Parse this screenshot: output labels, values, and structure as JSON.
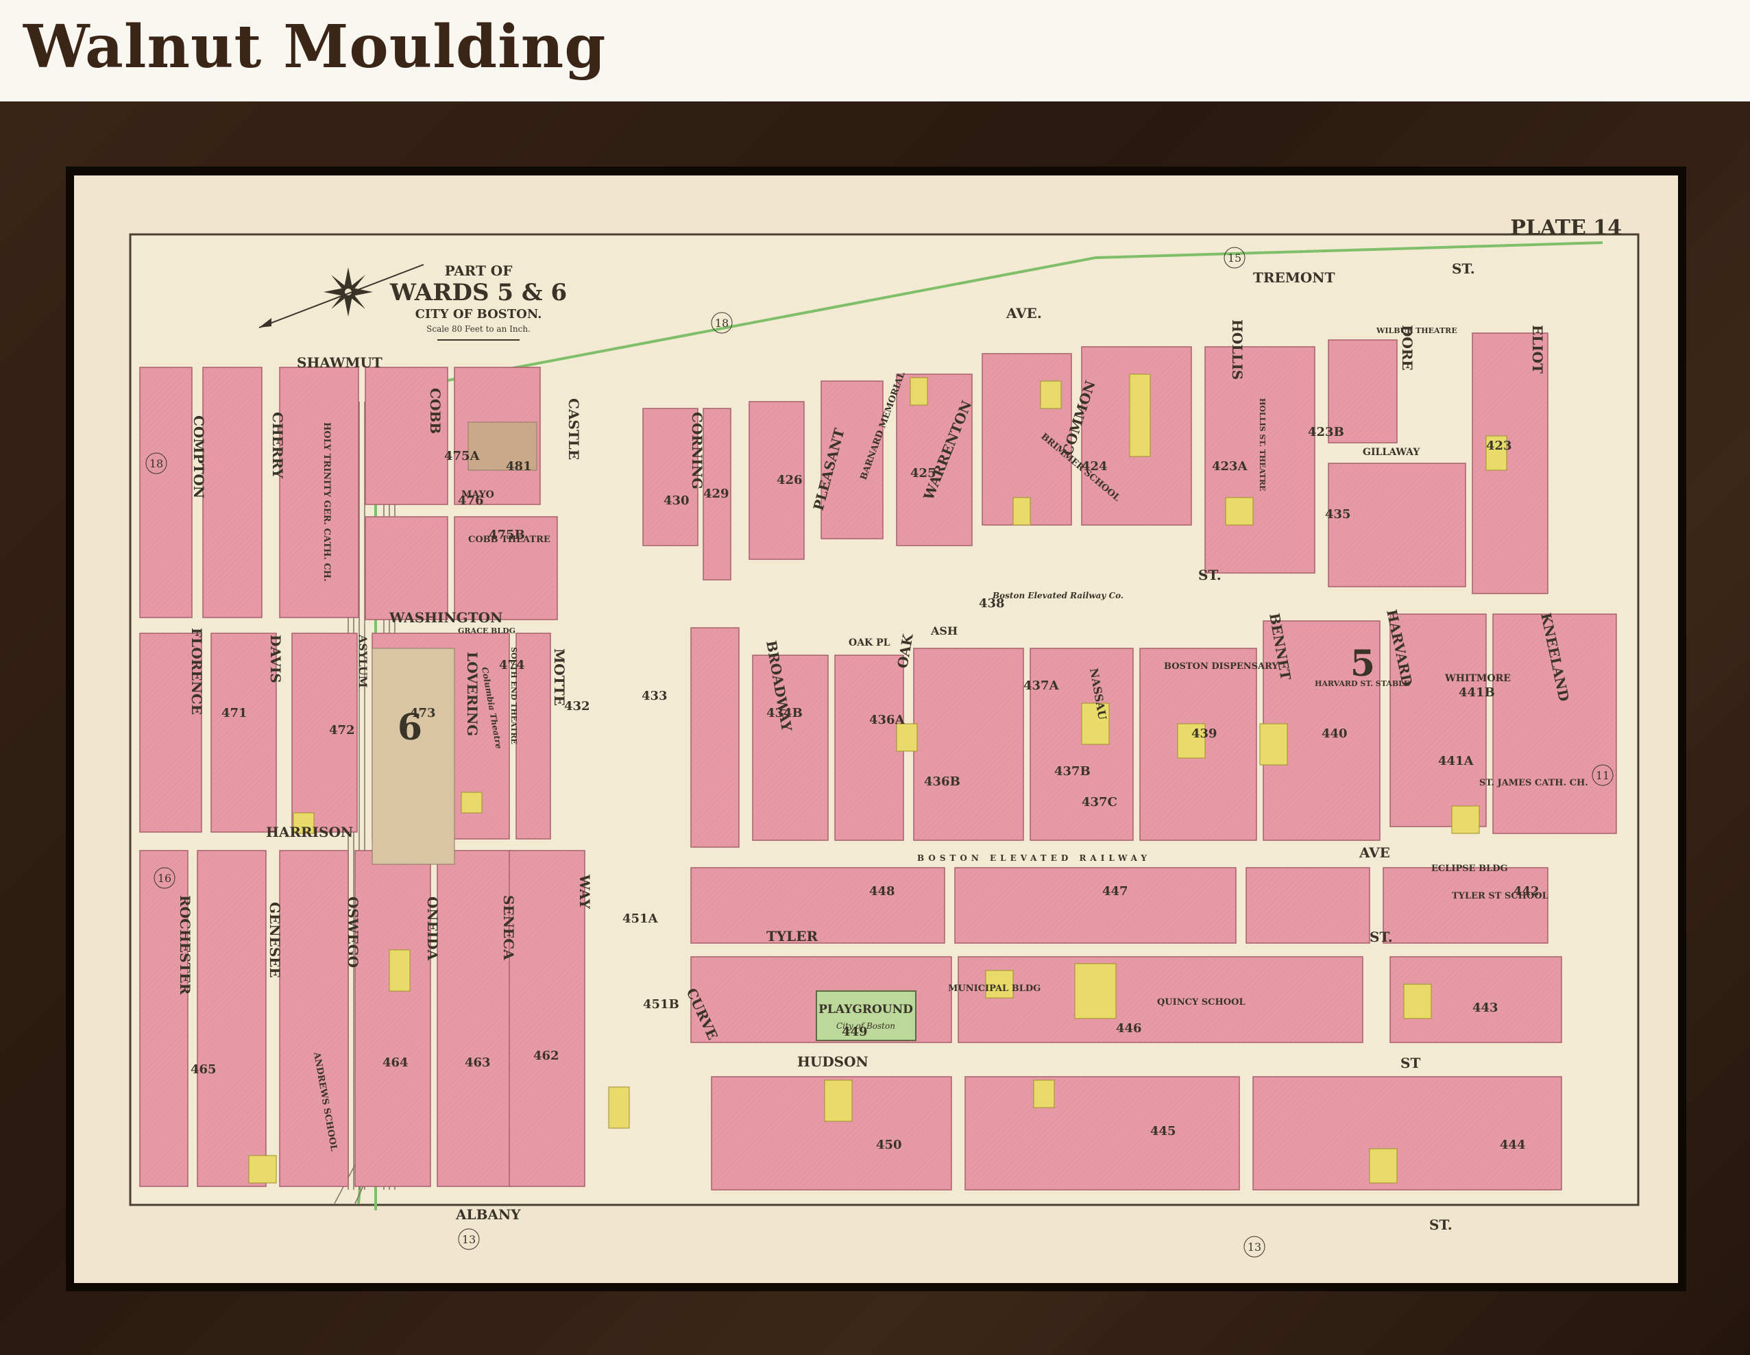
{
  "header": {
    "title": "Walnut Moulding"
  },
  "map": {
    "plate": "PLATE 14",
    "title": {
      "line1": "PART OF",
      "line2": "WARDS 5 & 6",
      "line3": "CITY OF BOSTON.",
      "scale": "Scale 80 Feet to an Inch."
    },
    "adjacent_plates": {
      "top": "15",
      "top_left": "18",
      "left_upper": "18",
      "left_lower": "16",
      "right": "11",
      "bottom_left": "13",
      "bottom_mid": "13"
    },
    "ward_numbers": {
      "ward6": "6",
      "ward5": "5"
    },
    "streets": {
      "tremont": "TREMONT",
      "ave_top": "AVE.",
      "st_top": "ST.",
      "shawmut": "SHAWMUT",
      "compton": "COMPTON",
      "cherry": "CHERRY",
      "cobb": "COBB",
      "castle": "CASTLE",
      "corning": "CORNING",
      "pleasant": "PLEASANT",
      "warrenton": "WARRENTON",
      "common": "COMMON",
      "hollis": "HOLLIS",
      "dore": "DORE",
      "eliot": "ELIOT",
      "mayo": "MAYO",
      "gillaway": "GILLAWAY",
      "washington": "WASHINGTON",
      "washington_st": "ST.",
      "florence": "FLORENCE",
      "davis": "DAVIS",
      "asylum": "ASYLUM",
      "lovering": "LOVERING",
      "motte": "MOTTE",
      "broadway": "BROADWAY",
      "oak": "OAK",
      "oak_pl": "OAK PL",
      "ash": "ASH",
      "nassau": "NASSAU",
      "bennet": "BENNET",
      "harvard": "HARVARD",
      "kneeland": "KNEELAND",
      "whitmore": "WHITMORE",
      "harrison": "HARRISON",
      "harrison_ave": "AVE",
      "rochester": "ROCHESTER",
      "genesee": "GENESEE",
      "oswego": "OSWEGO",
      "oneida": "ONEIDA",
      "seneca": "SENECA",
      "way": "WAY",
      "tyler": "TYLER",
      "tyler_st": "ST.",
      "curve": "CURVE",
      "hudson": "HUDSON",
      "hudson_st": "ST",
      "albany": "ALBANY",
      "albany_st": "ST.",
      "railway": "BOSTON ELEVATED RAILWAY"
    },
    "landmarks": {
      "holy_trinity": "HOLY TRINITY GER. CATH. CH.",
      "cobb_theatre": "COBB THEATRE",
      "brimmer": "BRIMMER SCHOOL",
      "barnard": "BARNARD MEMORIAL",
      "boston_dispensary": "BOSTON DISPENSARY",
      "st_james": "ST. JAMES CATH. CH.",
      "playground": "PLAYGROUND",
      "playground_sub": "City of Boston",
      "municipal": "MUNICIPAL BLDG",
      "quincy": "QUINCY SCHOOL",
      "tyler_school": "TYLER ST SCHOOL",
      "eclipse": "ECLIPSE BLDG",
      "andrews": "ANDREWS SCHOOL",
      "wilbur": "WILBUR THEATRE",
      "hollis_theatre": "HOLLIS ST. THEATRE",
      "harvard_stable": "HARVARD ST. STABLE",
      "grace_bldg": "GRACE BLDG",
      "south_end_theatre": "SOUTH END THEATRE",
      "columbia": "Columbia Theatre",
      "boston_elevated": "Boston Elevated Railway Co."
    },
    "block_numbers": [
      "475A",
      "476",
      "475B",
      "481",
      "430",
      "429",
      "426",
      "425",
      "424",
      "423A",
      "423B",
      "423",
      "435",
      "438",
      "5",
      "441B",
      "441A",
      "440",
      "439",
      "437A",
      "437B",
      "437C",
      "436A",
      "436B",
      "434B",
      "433",
      "432",
      "474",
      "473",
      "472",
      "471",
      "448",
      "447",
      "442",
      "451A",
      "451B",
      "449",
      "446",
      "443",
      "450",
      "445",
      "444",
      "465",
      "464",
      "463",
      "462"
    ],
    "colors": {
      "brick": "#e59aa6",
      "wood": "#e8db6a",
      "paper": "#f0e6cf",
      "park": "#bcd89a",
      "street": "#f3ead4",
      "frame": "#2e1c11"
    }
  }
}
